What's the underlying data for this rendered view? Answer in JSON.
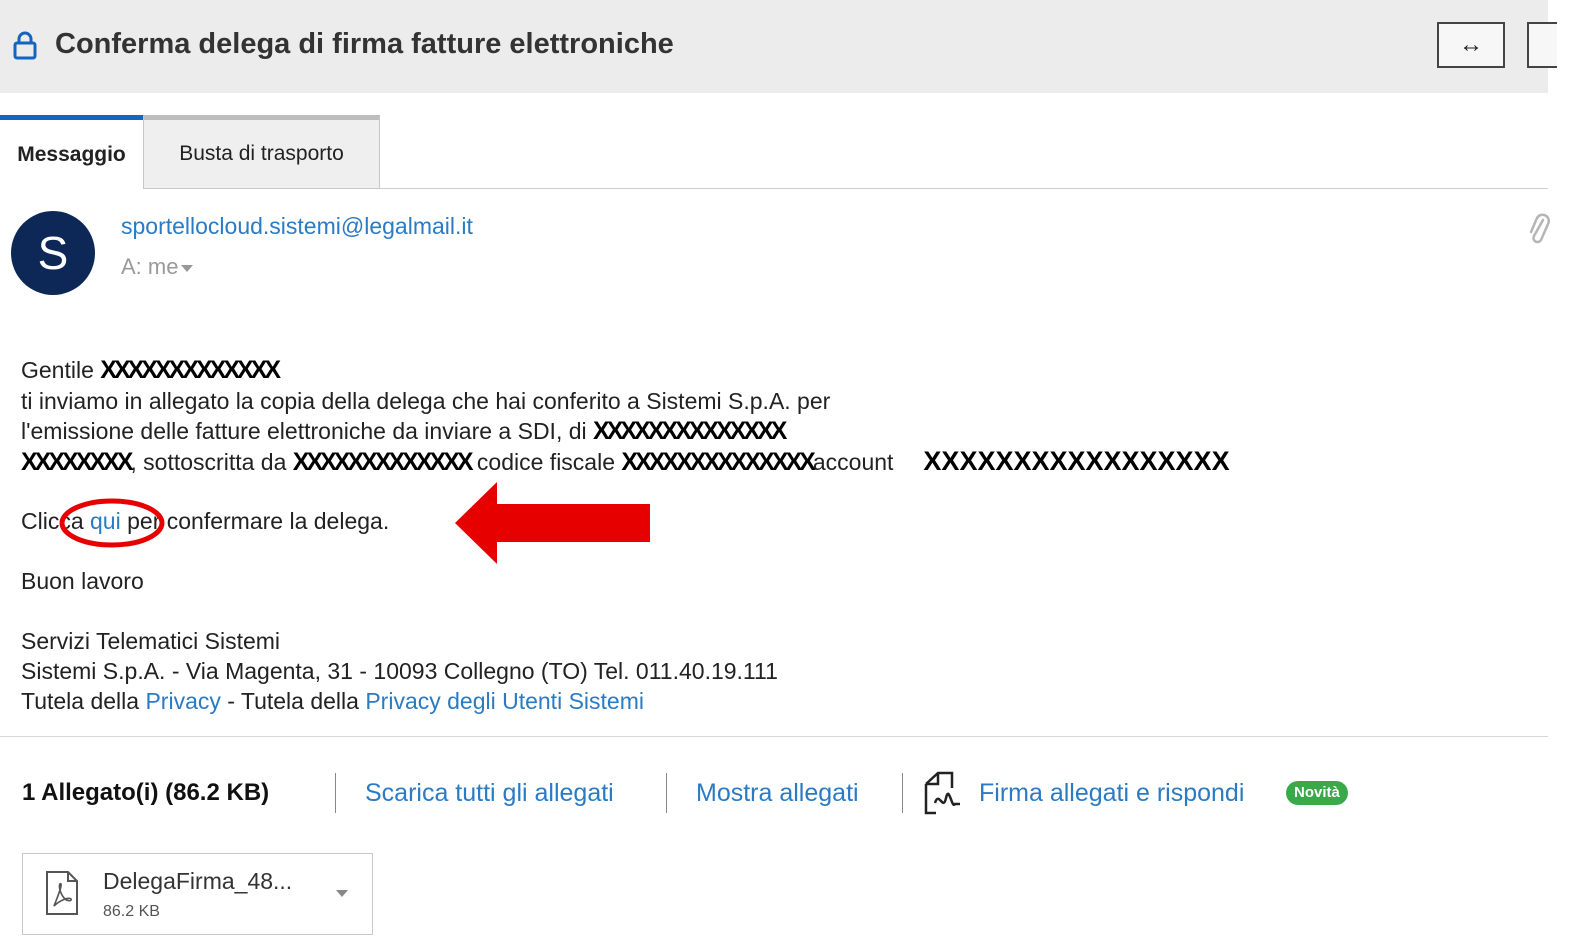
{
  "header": {
    "subject": "Conferma delega di firma fatture elettroniche",
    "expand_glyph": "↔",
    "lock_icon": "lock-icon"
  },
  "tabs": [
    {
      "label": "Messaggio",
      "active": true
    },
    {
      "label": "Busta di trasporto",
      "active": false
    }
  ],
  "sender": {
    "avatar_letter": "S",
    "email": "sportellocloud.sistemi@legalmail.it",
    "recipient": "A: me"
  },
  "body": {
    "l1_prefix": "Gentile ",
    "l1_redacted": "XXXXXXXXXXXXX",
    "l2": "ti inviamo in allegato la copia della delega che hai conferito a Sistemi S.p.A. per",
    "l3_prefix": "l'emissione delle fatture elettroniche da inviare a SDI, di ",
    "l3_redacted": "XXXXXXXXXXXXXX",
    "l4_redacted_a": "XXXXXXXX",
    "l4_text_a": ", sottoscritta da ",
    "l4_redacted_b": "XXXXXXXXXXXXX",
    "l4_text_b": " codice fiscale ",
    "l4_redacted_c": "XXXXXXXXXXXXXX",
    "l4_text_c": "account",
    "l4_redacted_d": "XXXXXXXXXXXXXXXXX",
    "l5_prefix": "Clicca ",
    "l5_link": "qui",
    "l5_suffix": " per confermare la delega.",
    "l6": "Buon lavoro",
    "l7": "Servizi Telematici Sistemi",
    "l8": "Sistemi S.p.A. - Via Magenta, 31 - 10093 Collegno (TO) Tel. 011.40.19.111",
    "l9_a": "Tutela della ",
    "l9_link1": "Privacy",
    "l9_b": " - Tutela della ",
    "l9_link2": "Privacy degli Utenti Sistemi"
  },
  "attachments_bar": {
    "count_label": "1 Allegato(i) (86.2 KB)",
    "download_all": "Scarica tutti gli allegati",
    "show": "Mostra allegati",
    "sign_reply": "Firma allegati e rispondi",
    "badge": "Novità"
  },
  "attachment": {
    "name": "DelegaFirma_48...",
    "size": "86.2 KB"
  },
  "colors": {
    "link": "#2a7bc4",
    "avatar_bg": "#0d2857",
    "annotation_red": "#e60000",
    "badge_green": "#3aa94a",
    "active_tab_accent": "#1565c0"
  }
}
